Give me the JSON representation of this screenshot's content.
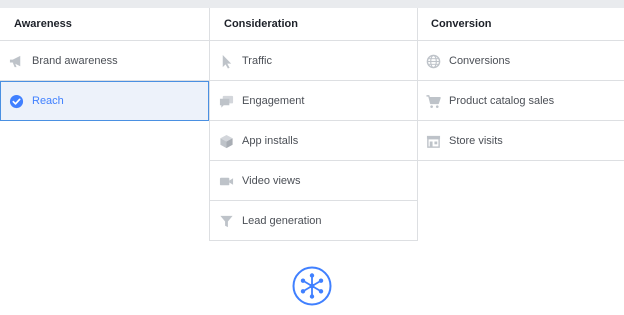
{
  "columns": [
    {
      "header": "Awareness",
      "items": [
        {
          "label": "Brand awareness",
          "icon": "megaphone-icon",
          "selected": false
        },
        {
          "label": "Reach",
          "icon": "checkmark-circle-icon",
          "selected": true
        }
      ]
    },
    {
      "header": "Consideration",
      "items": [
        {
          "label": "Traffic",
          "icon": "cursor-icon"
        },
        {
          "label": "Engagement",
          "icon": "chat-bubbles-icon"
        },
        {
          "label": "App installs",
          "icon": "cube-icon"
        },
        {
          "label": "Video views",
          "icon": "video-camera-icon"
        },
        {
          "label": "Lead generation",
          "icon": "funnel-icon"
        }
      ]
    },
    {
      "header": "Conversion",
      "items": [
        {
          "label": "Conversions",
          "icon": "globe-icon"
        },
        {
          "label": "Product catalog sales",
          "icon": "shopping-cart-icon"
        },
        {
          "label": "Store visits",
          "icon": "storefront-icon"
        }
      ]
    }
  ],
  "colors": {
    "accent": "#4080ff",
    "selected_bg": "#edf2fa",
    "icon_gray": "#bec3c9",
    "border": "#dddfe2"
  },
  "hub_icon": "network-hub-icon"
}
